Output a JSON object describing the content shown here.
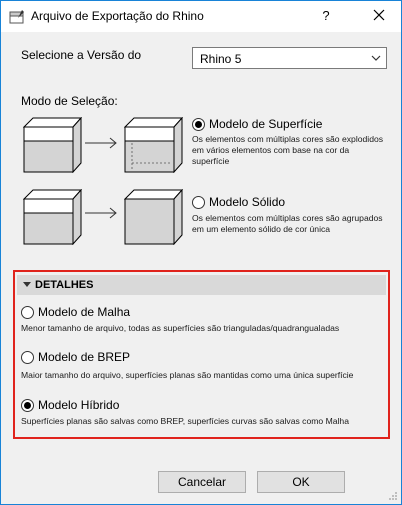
{
  "window": {
    "title": "Arquivo de Exportação do Rhino",
    "help": "?",
    "close_icon": "close-icon"
  },
  "version": {
    "label": "Selecione a Versão do",
    "selected": "Rhino 5"
  },
  "selection_mode": {
    "label": "Modo de Seleção:",
    "options": [
      {
        "label": "Modelo de Superfície",
        "description": [
          "Os elementos com múltiplas cores são explodidos",
          "em vários elementos com base na cor da",
          "superfície"
        ],
        "selected": true
      },
      {
        "label": "Modelo Sólido",
        "description": [
          "Os elementos com múltiplas cores são agrupados",
          "em um elemento sólido de cor única"
        ],
        "selected": false
      }
    ]
  },
  "details": {
    "title": "DETALHES",
    "options": [
      {
        "label": "Modelo de Malha",
        "description": "Menor tamanho de arquivo, todas as superfícies são trianguladas/quadrangualadas",
        "selected": false
      },
      {
        "label": "Modelo de BREP",
        "description": "Maior tamanho do arquivo, superfícies planas são mantidas como uma única superfície",
        "selected": false
      },
      {
        "label": "Modelo Híbrido",
        "description": "Superfícies planas são salvas como BREP, superfícies curvas são salvas como Malha",
        "selected": true
      }
    ]
  },
  "buttons": {
    "cancel": "Cancelar",
    "ok": "OK"
  },
  "colors": {
    "highlight_border": "#e0231c",
    "window_border": "#1883d7"
  }
}
